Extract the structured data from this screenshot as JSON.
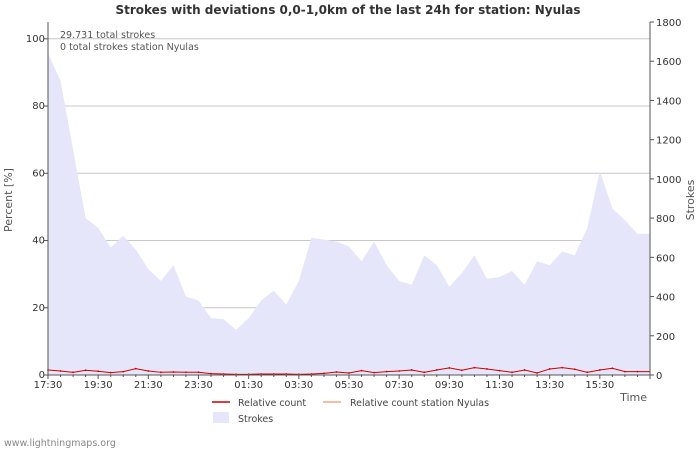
{
  "chart_data": {
    "type": "area",
    "title": "Strokes with deviations 0,0-1,0km of the last 24h for station: Nyulas",
    "ylabel_left": "Percent   [%]",
    "ylabel_right": "Strokes",
    "xlabel": "Time",
    "ylim_left": [
      0,
      105
    ],
    "ylim_right": [
      0,
      1800
    ],
    "y_ticks_left": [
      0,
      20,
      40,
      60,
      80,
      100
    ],
    "y_ticks_right": [
      0,
      200,
      400,
      600,
      800,
      1000,
      1200,
      1400,
      1600,
      1800
    ],
    "x_tick_labels": [
      "17:30",
      "19:30",
      "21:30",
      "23:30",
      "01:30",
      "03:30",
      "05:30",
      "07:30",
      "09:30",
      "11:30",
      "13:30",
      "15:30"
    ],
    "annotations": [
      "29.731 total strokes",
      "0 total strokes station Nyulas"
    ],
    "grid": true,
    "legend_position": "bottom",
    "series": [
      {
        "name": "Strokes",
        "kind": "area",
        "axis": "right",
        "color": "#e6e6fa",
        "values": [
          1640,
          1500,
          1150,
          800,
          750,
          650,
          710,
          640,
          540,
          480,
          560,
          400,
          380,
          290,
          285,
          230,
          290,
          380,
          430,
          360,
          480,
          700,
          690,
          680,
          655,
          580,
          680,
          560,
          480,
          460,
          610,
          560,
          450,
          520,
          610,
          490,
          500,
          530,
          460,
          580,
          560,
          630,
          610,
          750,
          1040,
          850,
          790,
          720
        ]
      },
      {
        "name": "Relative count",
        "kind": "line",
        "axis": "left",
        "color": "#cc0000",
        "values": [
          1.5,
          1.2,
          0.8,
          1.4,
          1.1,
          0.7,
          1.0,
          1.9,
          1.2,
          0.8,
          0.9,
          0.8,
          0.8,
          0.4,
          0.3,
          0.2,
          0.2,
          0.3,
          0.3,
          0.3,
          0.2,
          0.3,
          0.5,
          0.9,
          0.6,
          1.3,
          0.7,
          1.0,
          1.2,
          1.5,
          0.8,
          1.5,
          2.1,
          1.4,
          2.2,
          1.8,
          1.3,
          0.8,
          1.5,
          0.6,
          1.8,
          2.2,
          1.7,
          0.8,
          1.5,
          2.0,
          1.0,
          1.0
        ]
      },
      {
        "name": "Relative count station Nyulas",
        "kind": "line",
        "axis": "left",
        "color": "#f4a582",
        "values": [
          0,
          0,
          0,
          0,
          0,
          0,
          0,
          0,
          0,
          0,
          0,
          0,
          0,
          0,
          0,
          0,
          0,
          0,
          0,
          0,
          0,
          0,
          0,
          0,
          0,
          0,
          0,
          0,
          0,
          0,
          0,
          0,
          0,
          0,
          0,
          0,
          0,
          0,
          0,
          0,
          0,
          0,
          0,
          0,
          0,
          0,
          0,
          0
        ]
      }
    ]
  },
  "watermark": "www.lightningmaps.org"
}
